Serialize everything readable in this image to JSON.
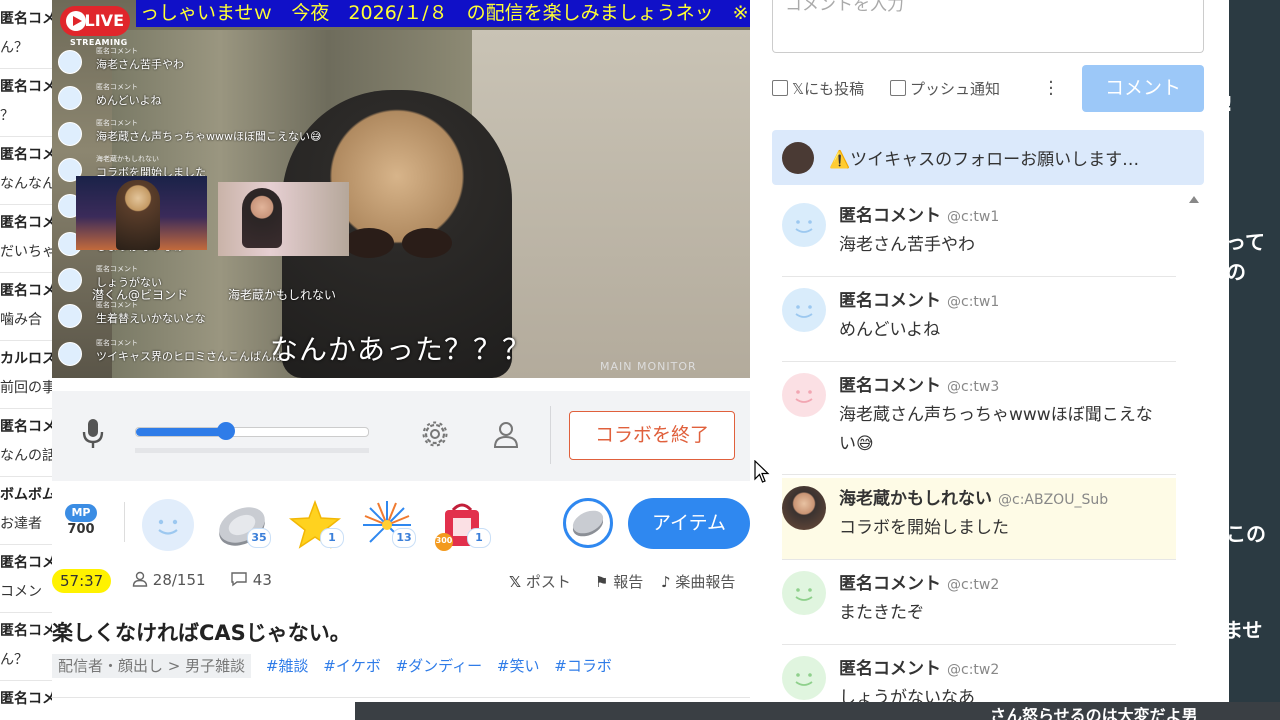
{
  "background": {
    "right_fragments": [
      "!",
      "って",
      "の",
      "この",
      "ませ"
    ],
    "bottom_fragment": "さん怒らせるのは大変だよ男"
  },
  "left_list": [
    {
      "name": "匿名コメ",
      "text": "ん？"
    },
    {
      "name": "匿名コメ",
      "text": "？"
    },
    {
      "name": "匿名コメ",
      "text": "なんなん"
    },
    {
      "name": "匿名コメ",
      "text": "だいちゃ"
    },
    {
      "name": "匿名コメ",
      "text": "噛み合"
    },
    {
      "name": "カルロス",
      "text": "前回の事"
    },
    {
      "name": "匿名コメ",
      "text": "なんの話"
    },
    {
      "name": "ボムボム",
      "text": "お達者"
    },
    {
      "name": "匿名コメ",
      "text": "コメン"
    },
    {
      "name": "匿名コメ",
      "text": "ん？"
    },
    {
      "name": "匿名コメ",
      "text": ""
    }
  ],
  "video": {
    "ticker": "っしゃいませｗ　今夜　2026/１/８　の配信を楽しみましょうネッ　※",
    "live_label": "LIVE",
    "streaming_label": "STREAMING",
    "overlay_comments": [
      {
        "name": "匿名コメント",
        "text": "海老さん苦手やわ"
      },
      {
        "name": "匿名コメント",
        "text": "めんどいよね"
      },
      {
        "name": "匿名コメント",
        "text": "海老蔵さん声ちっちゃwwwほぼ聞こえない😅"
      },
      {
        "name": "海老蔵かもしれない",
        "text": "コラボを開始しました"
      },
      {
        "name": "匿名コメント",
        "text": "またきたぞ"
      },
      {
        "name": "匿名コメント",
        "text": "しょうがないなあ"
      },
      {
        "name": "匿名コメント",
        "text": "しょうがない"
      },
      {
        "name": "匿名コメント",
        "text": "生着替えいかないとな"
      },
      {
        "name": "匿名コメント",
        "text": "ツイキャス界のヒロミさんこんばんは"
      }
    ],
    "collab_left_label": "潜くん@ビヨンド",
    "collab_right_label": "海老蔵かもしれない",
    "subtitle": "なんかあった？？？",
    "watermark": "MAIN MONITOR"
  },
  "controls": {
    "volume_fraction": 0.39,
    "end_collab_label": "コラボを終了"
  },
  "items": {
    "mp_label": "MP",
    "mp_value": "700",
    "gifts": [
      {
        "icon": "smile-face-icon",
        "count": ""
      },
      {
        "icon": "coin-icon",
        "count": "35"
      },
      {
        "icon": "star-icon",
        "count": "1"
      },
      {
        "icon": "firework-icon",
        "count": "13"
      },
      {
        "icon": "lucky-bag-icon",
        "count": "1",
        "badge": "300"
      }
    ],
    "item_button_label": "アイテム"
  },
  "stats": {
    "timer": "57:37",
    "viewers": "28/151",
    "comments": "43",
    "post_label": "ポスト",
    "report_label": "報告",
    "music_report_label": "楽曲報告"
  },
  "broadcast": {
    "title": "楽しくなければCASじゃない。",
    "category": "配信者・顔出し > 男子雑談",
    "tags": [
      "#雑談",
      "#イケボ",
      "#ダンディー",
      "#笑い",
      "#コラボ"
    ]
  },
  "comment_form": {
    "placeholder": "コメントを入力",
    "x_post_label": "𝕏にも投稿",
    "push_label": "プッシュ通知",
    "submit_label": "コメント"
  },
  "notice": {
    "text": "⚠️ツイキャスのフォローお願いします…"
  },
  "comments": [
    {
      "name": "匿名コメント",
      "id": "@c:tw1",
      "text": "海老さん苦手やわ",
      "avatar_color": "#d9ecfb",
      "face_color": "#9cc8f0",
      "highlight": false
    },
    {
      "name": "匿名コメント",
      "id": "@c:tw1",
      "text": "めんどいよね",
      "avatar_color": "#d9ecfb",
      "face_color": "#9cc8f0",
      "highlight": false
    },
    {
      "name": "匿名コメント",
      "id": "@c:tw3",
      "text": "海老蔵さん声ちっちゃwwwほぼ聞こえない😅",
      "avatar_color": "#fbe0e4",
      "face_color": "#f2a6b2",
      "highlight": false
    },
    {
      "name": "海老蔵かもしれない",
      "id": "@c:ABZOU_Sub",
      "text": "コラボを開始しました",
      "avatar_color": "#b88a6a",
      "face_color": "",
      "highlight": true
    },
    {
      "name": "匿名コメント",
      "id": "@c:tw2",
      "text": "またきたぞ",
      "avatar_color": "#e0f5df",
      "face_color": "#8fd08c",
      "highlight": false
    },
    {
      "name": "匿名コメント",
      "id": "@c:tw2",
      "text": "しょうがないなあ",
      "avatar_color": "#e0f5df",
      "face_color": "#8fd08c",
      "highlight": false
    }
  ],
  "colors": {
    "accent": "#2f88f0",
    "end_collab": "#e0603c",
    "ticker_bg": "#1010c8",
    "ticker_text": "#ffff33",
    "timer_bg": "#fff200",
    "highlight_bg": "#fefbe6"
  }
}
